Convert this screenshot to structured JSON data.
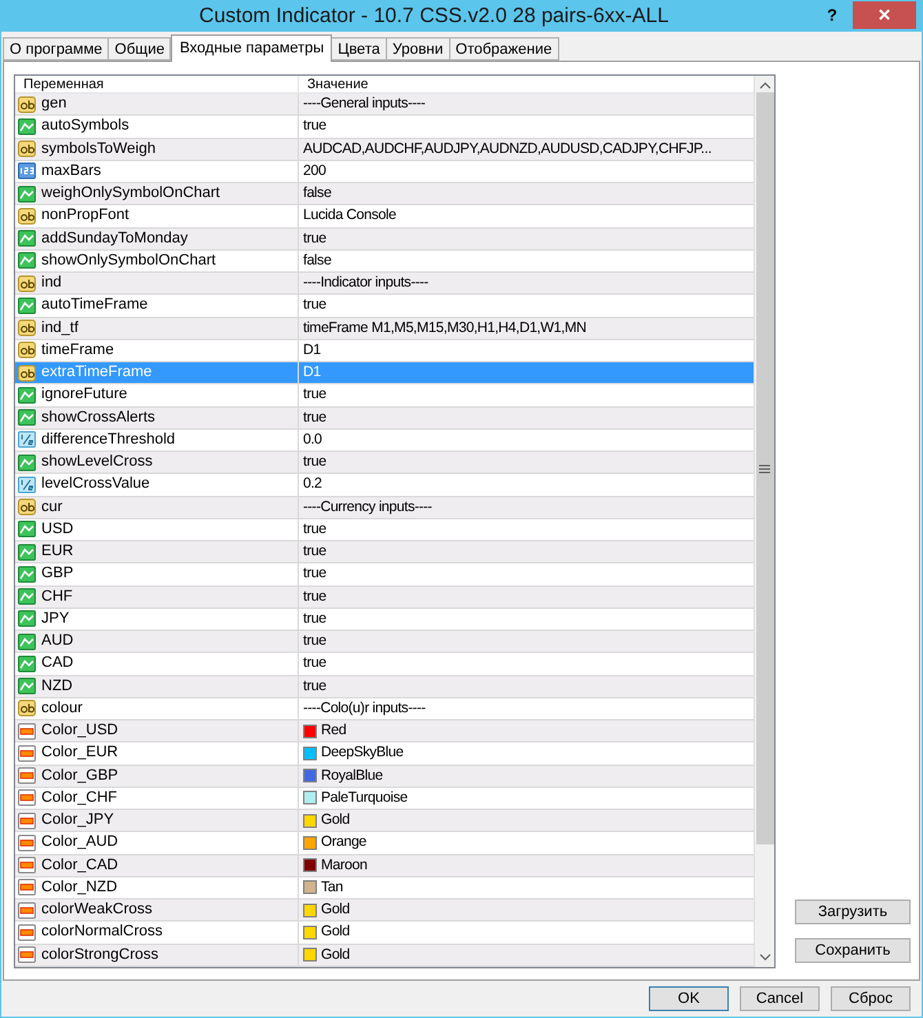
{
  "window": {
    "title": "Custom Indicator - 10.7 CSS.v2.0 28 pairs-6xx-ALL",
    "help_button": "?",
    "close_button": "✕"
  },
  "tabs": [
    {
      "label": "О программе",
      "selected": false
    },
    {
      "label": "Общие",
      "selected": false
    },
    {
      "label": "Входные параметры",
      "selected": true
    },
    {
      "label": "Цвета",
      "selected": false
    },
    {
      "label": "Уровни",
      "selected": false
    },
    {
      "label": "Отображение",
      "selected": false
    }
  ],
  "table": {
    "columns": [
      "Переменная",
      "Значение"
    ],
    "rows": [
      {
        "kind": "string",
        "name": "gen",
        "value": "----General inputs----",
        "selected": false
      },
      {
        "kind": "bool",
        "name": "autoSymbols",
        "value": "true",
        "selected": false
      },
      {
        "kind": "string",
        "name": "symbolsToWeigh",
        "value": "AUDCAD,AUDCHF,AUDJPY,AUDNZD,AUDUSD,CADJPY,CHFJP...",
        "selected": false
      },
      {
        "kind": "int",
        "name": "maxBars",
        "value": "200",
        "selected": false
      },
      {
        "kind": "bool",
        "name": "weighOnlySymbolOnChart",
        "value": "false",
        "selected": false
      },
      {
        "kind": "string",
        "name": "nonPropFont",
        "value": "Lucida Console",
        "selected": false
      },
      {
        "kind": "bool",
        "name": "addSundayToMonday",
        "value": "true",
        "selected": false
      },
      {
        "kind": "bool",
        "name": "showOnlySymbolOnChart",
        "value": "false",
        "selected": false
      },
      {
        "kind": "string",
        "name": "ind",
        "value": "----Indicator inputs----",
        "selected": false
      },
      {
        "kind": "bool",
        "name": "autoTimeFrame",
        "value": "true",
        "selected": false
      },
      {
        "kind": "string",
        "name": "ind_tf",
        "value": "timeFrame M1,M5,M15,M30,H1,H4,D1,W1,MN",
        "selected": false
      },
      {
        "kind": "string",
        "name": "timeFrame",
        "value": "D1",
        "selected": false
      },
      {
        "kind": "string",
        "name": "extraTimeFrame",
        "value": "D1",
        "selected": true
      },
      {
        "kind": "bool",
        "name": "ignoreFuture",
        "value": "true",
        "selected": false
      },
      {
        "kind": "bool",
        "name": "showCrossAlerts",
        "value": "true",
        "selected": false
      },
      {
        "kind": "double",
        "name": "differenceThreshold",
        "value": "0.0",
        "selected": false
      },
      {
        "kind": "bool",
        "name": "showLevelCross",
        "value": "true",
        "selected": false
      },
      {
        "kind": "double",
        "name": "levelCrossValue",
        "value": "0.2",
        "selected": false
      },
      {
        "kind": "string",
        "name": "cur",
        "value": "----Currency inputs----",
        "selected": false
      },
      {
        "kind": "bool",
        "name": "USD",
        "value": "true",
        "selected": false
      },
      {
        "kind": "bool",
        "name": "EUR",
        "value": "true",
        "selected": false
      },
      {
        "kind": "bool",
        "name": "GBP",
        "value": "true",
        "selected": false
      },
      {
        "kind": "bool",
        "name": "CHF",
        "value": "true",
        "selected": false
      },
      {
        "kind": "bool",
        "name": "JPY",
        "value": "true",
        "selected": false
      },
      {
        "kind": "bool",
        "name": "AUD",
        "value": "true",
        "selected": false
      },
      {
        "kind": "bool",
        "name": "CAD",
        "value": "true",
        "selected": false
      },
      {
        "kind": "bool",
        "name": "NZD",
        "value": "true",
        "selected": false
      },
      {
        "kind": "string",
        "name": "colour",
        "value": "----Colo(u)r inputs----",
        "selected": false
      },
      {
        "kind": "color",
        "name": "Color_USD",
        "value": "Red",
        "color": "#ff0000",
        "selected": false
      },
      {
        "kind": "color",
        "name": "Color_EUR",
        "value": "DeepSkyBlue",
        "color": "#00bfff",
        "selected": false
      },
      {
        "kind": "color",
        "name": "Color_GBP",
        "value": "RoyalBlue",
        "color": "#4169e1",
        "selected": false
      },
      {
        "kind": "color",
        "name": "Color_CHF",
        "value": "PaleTurquoise",
        "color": "#afeeee",
        "selected": false
      },
      {
        "kind": "color",
        "name": "Color_JPY",
        "value": "Gold",
        "color": "#ffd700",
        "selected": false
      },
      {
        "kind": "color",
        "name": "Color_AUD",
        "value": "Orange",
        "color": "#ffa500",
        "selected": false
      },
      {
        "kind": "color",
        "name": "Color_CAD",
        "value": "Maroon",
        "color": "#800000",
        "selected": false
      },
      {
        "kind": "color",
        "name": "Color_NZD",
        "value": "Tan",
        "color": "#d2b48c",
        "selected": false
      },
      {
        "kind": "color",
        "name": "colorWeakCross",
        "value": "Gold",
        "color": "#ffd700",
        "selected": false
      },
      {
        "kind": "color",
        "name": "colorNormalCross",
        "value": "Gold",
        "color": "#ffd700",
        "selected": false
      },
      {
        "kind": "color",
        "name": "colorStrongCross",
        "value": "Gold",
        "color": "#ffd700",
        "selected": false
      }
    ]
  },
  "side_buttons": [
    "Загрузить",
    "Сохранить"
  ],
  "footer_buttons": [
    "OK",
    "Cancel",
    "Сброс"
  ]
}
